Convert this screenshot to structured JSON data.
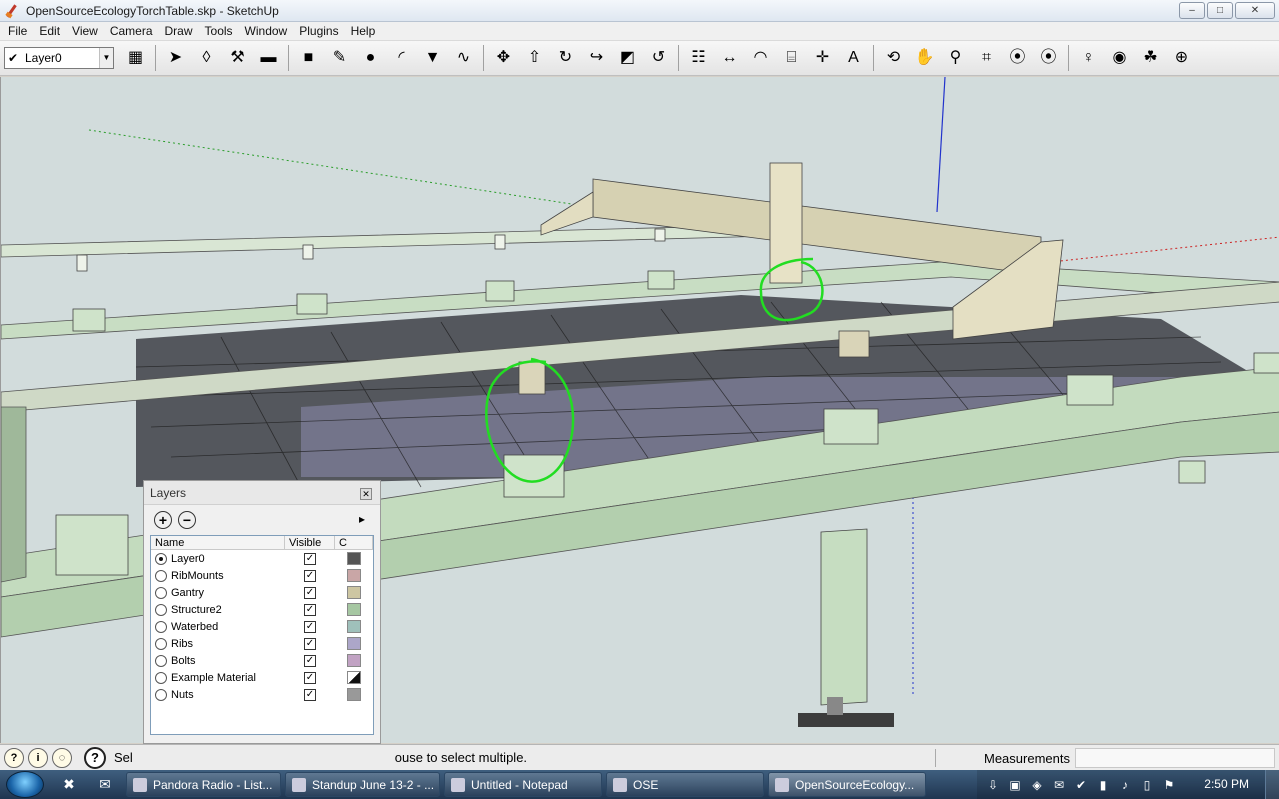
{
  "window": {
    "title": "OpenSourceEcologyTorchTable.skp - SketchUp",
    "controls": {
      "minimize": "–",
      "maximize": "□",
      "close": "✕"
    }
  },
  "menu": [
    "File",
    "Edit",
    "View",
    "Camera",
    "Draw",
    "Tools",
    "Window",
    "Plugins",
    "Help"
  ],
  "toolbar": {
    "layer_value": "Layer0",
    "tools": [
      {
        "name": "layer-manager-icon",
        "glyph": "▦"
      },
      {
        "name": "select-arrow-icon",
        "glyph": "➤"
      },
      {
        "name": "make-component-icon",
        "glyph": "◊"
      },
      {
        "name": "paint-bucket-icon",
        "glyph": "⚒"
      },
      {
        "name": "eraser-icon",
        "glyph": "▬"
      },
      {
        "name": "rectangle-icon",
        "glyph": "■"
      },
      {
        "name": "pencil-line-icon",
        "glyph": "✎"
      },
      {
        "name": "circle-icon",
        "glyph": "●"
      },
      {
        "name": "arc-icon",
        "glyph": "◜"
      },
      {
        "name": "polygon-icon",
        "glyph": "▼"
      },
      {
        "name": "freehand-icon",
        "glyph": "∿"
      },
      {
        "name": "move-icon",
        "glyph": "✥"
      },
      {
        "name": "push-pull-icon",
        "glyph": "⇧"
      },
      {
        "name": "rotate-icon",
        "glyph": "↻"
      },
      {
        "name": "follow-me-icon",
        "glyph": "↪"
      },
      {
        "name": "scale-icon",
        "glyph": "◩"
      },
      {
        "name": "offset-icon",
        "glyph": "↺"
      },
      {
        "name": "tape-measure-icon",
        "glyph": "☷"
      },
      {
        "name": "dimension-icon",
        "glyph": "↔"
      },
      {
        "name": "protractor-icon",
        "glyph": "◠"
      },
      {
        "name": "text-icon",
        "glyph": "⌸"
      },
      {
        "name": "axes-icon",
        "glyph": "✛"
      },
      {
        "name": "3d-text-icon",
        "glyph": "A"
      },
      {
        "name": "orbit-icon",
        "glyph": "⟲"
      },
      {
        "name": "pan-icon",
        "glyph": "✋"
      },
      {
        "name": "zoom-icon",
        "glyph": "⚲"
      },
      {
        "name": "zoom-window-icon",
        "glyph": "⌗"
      },
      {
        "name": "zoom-extents-icon",
        "glyph": "⦿"
      },
      {
        "name": "previous-view-icon",
        "glyph": "⦿"
      },
      {
        "name": "position-camera-icon",
        "glyph": "♀"
      },
      {
        "name": "look-around-icon",
        "glyph": "◉"
      },
      {
        "name": "walk-icon",
        "glyph": "☘"
      },
      {
        "name": "section-plane-icon",
        "glyph": "⊕"
      }
    ]
  },
  "layers_panel": {
    "title": "Layers",
    "close_glyph": "✕",
    "add_glyph": "+",
    "remove_glyph": "−",
    "details_glyph": "▸",
    "headers": {
      "name": "Name",
      "visible": "Visible",
      "color": "C"
    },
    "rows": [
      {
        "name": "Layer0",
        "active": true,
        "visible": true,
        "color": "#555555"
      },
      {
        "name": "RibMounts",
        "active": false,
        "visible": true,
        "color": "#c9a6a6"
      },
      {
        "name": "Gantry",
        "active": false,
        "visible": true,
        "color": "#cdc6a2"
      },
      {
        "name": "Structure2",
        "active": false,
        "visible": true,
        "color": "#a6c7a2"
      },
      {
        "name": "Waterbed",
        "active": false,
        "visible": true,
        "color": "#9fc0bb"
      },
      {
        "name": "Ribs",
        "active": false,
        "visible": true,
        "color": "#aca6c9"
      },
      {
        "name": "Bolts",
        "active": false,
        "visible": true,
        "color": "#c1a2c3"
      },
      {
        "name": "Example Material",
        "active": false,
        "visible": true,
        "color": "#111111"
      },
      {
        "name": "Nuts",
        "active": false,
        "visible": true,
        "color": "#999999"
      }
    ]
  },
  "status": {
    "text": "Sel",
    "text_tail": "ouse to select multiple.",
    "measurements_label": "Measurements",
    "measurements_value": ""
  },
  "taskbar": {
    "buttons": [
      {
        "label": "Pandora Radio - List...",
        "active": false
      },
      {
        "label": "Standup June 13-2 - ...",
        "active": false
      },
      {
        "label": "Untitled - Notepad",
        "active": false
      },
      {
        "label": "OSE",
        "active": false
      },
      {
        "label": "OpenSourceEcology...",
        "active": true
      }
    ],
    "clock": "2:50 PM"
  },
  "colors": {
    "frame": "#c8ddc3",
    "gantry": "#dcd7b9",
    "water": "#4a4c55",
    "annotation": "#22dd22",
    "sky": "#d2dcdc"
  }
}
